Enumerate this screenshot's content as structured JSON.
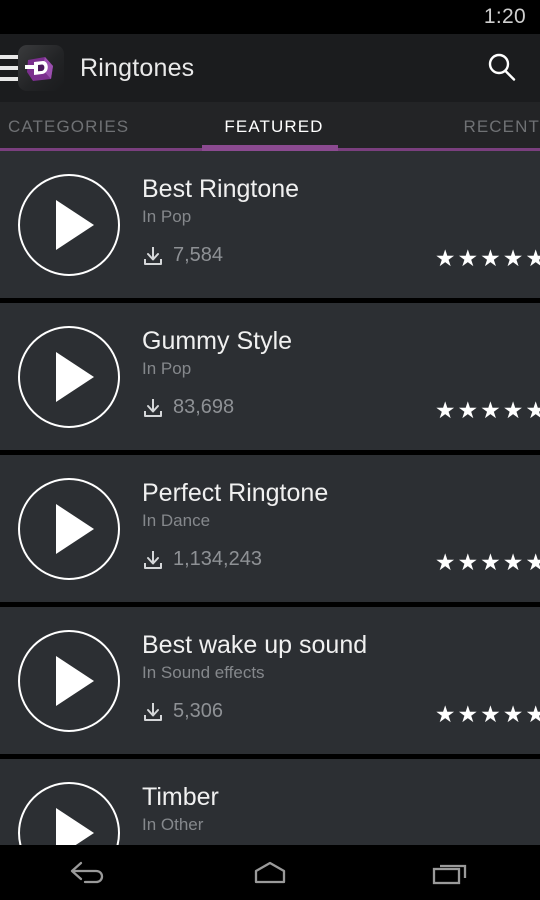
{
  "status_bar": {
    "time": "1:20"
  },
  "action_bar": {
    "title": "Ringtones",
    "menu_icon": "hamburger-menu-icon",
    "app_icon": "zedge-d-logo-icon",
    "search_icon": "search-icon"
  },
  "tabs": {
    "items": [
      {
        "label": "CATEGORIES",
        "active": false
      },
      {
        "label": "FEATURED",
        "active": true
      },
      {
        "label": "RECENT",
        "active": false
      }
    ],
    "accent_color": "#8b4a90",
    "underline_color": "#7a3f7e"
  },
  "list": {
    "rows": [
      {
        "title": "Best Ringtone",
        "subtitle": "In Pop",
        "downloads": "7,584",
        "rating": 5
      },
      {
        "title": "Gummy Style",
        "subtitle": "In Pop",
        "downloads": "83,698",
        "rating": 5
      },
      {
        "title": "Perfect Ringtone",
        "subtitle": "In Dance",
        "downloads": "1,134,243",
        "rating": 5
      },
      {
        "title": "Best wake up sound",
        "subtitle": "In Sound effects",
        "downloads": "5,306",
        "rating": 5
      },
      {
        "title": "Timber",
        "subtitle": "In Other",
        "downloads": "",
        "rating": 0
      }
    ],
    "play_icon": "play-icon",
    "download_icon": "download-icon",
    "star_icon": "star-filled-icon",
    "star_glyph": "★",
    "row_background": "#2c2f33"
  },
  "nav_bar": {
    "back_label": "back-icon",
    "home_label": "home-icon",
    "recents_label": "recents-icon"
  }
}
